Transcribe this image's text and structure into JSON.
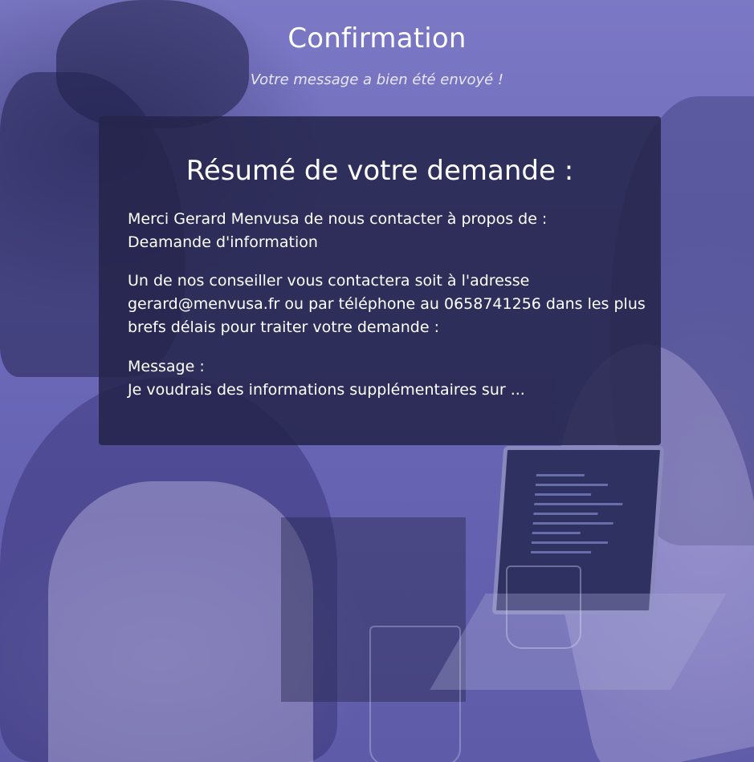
{
  "page": {
    "title": "Confirmation",
    "subtitle": "Votre message a bien été envoyé !"
  },
  "summary": {
    "title": "Résumé de votre demande :",
    "thanks_line": "Merci Gerard Menvusa de nous contacter à propos de :",
    "subject": "Deamande d'information",
    "contact_line_1": "Un de nos conseiller vous contactera soit à l'adresse",
    "contact_line_2": "gerard@menvusa.fr ou par téléphone au 0658741256 dans les plus",
    "contact_line_3": "brefs délais pour traiter votre demande :",
    "message_label": "Message :",
    "message_text": "Je voudrais des informations supplémentaires sur ..."
  },
  "colors": {
    "background_tint": "#6a67b6",
    "card_background": "#24244a",
    "text": "#ffffff"
  }
}
